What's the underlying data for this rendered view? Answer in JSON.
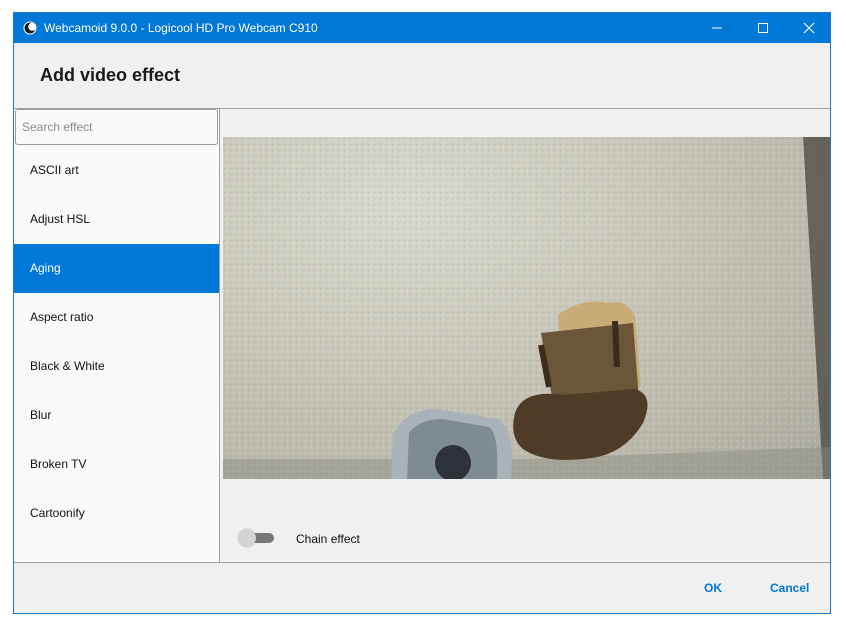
{
  "window": {
    "title": "Webcamoid 9.0.0 - Logicool HD Pro Webcam C910",
    "accent_color": "#0078d7",
    "icons": [
      "app-moon-icon",
      "minimize-icon",
      "maximize-icon",
      "close-icon"
    ]
  },
  "header": {
    "title": "Add video effect"
  },
  "sidebar": {
    "search_placeholder": "Search effect",
    "search_value": "",
    "items": [
      {
        "label": "ASCII art"
      },
      {
        "label": "Adjust HSL"
      },
      {
        "label": "Aging",
        "selected": true
      },
      {
        "label": "Aspect ratio"
      },
      {
        "label": "Black & White"
      },
      {
        "label": "Blur"
      },
      {
        "label": "Broken TV"
      },
      {
        "label": "Cartoonify"
      }
    ]
  },
  "content": {
    "chain_label": "Chain effect",
    "chain_enabled": false
  },
  "footer": {
    "ok_label": "OK",
    "cancel_label": "Cancel"
  }
}
